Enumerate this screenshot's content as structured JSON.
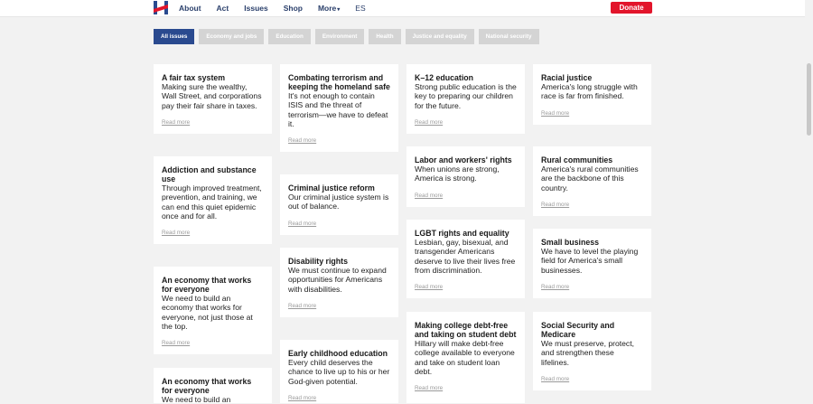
{
  "nav": {
    "items": [
      "About",
      "Act",
      "Issues",
      "Shop",
      "More"
    ],
    "lang": "ES",
    "donate": "Donate"
  },
  "colors": {
    "brand_blue": "#2a4a8f",
    "donate_red": "#e2152b",
    "nav_text": "#2a3f6b"
  },
  "filters": [
    "All issues",
    "Economy and jobs",
    "Education",
    "Environment",
    "Health",
    "Justice and equality",
    "National security"
  ],
  "read_more": "Read more",
  "cards": [
    {
      "title": "A fair tax system",
      "text": "Making sure the wealthy, Wall Street, and corporations pay their fair share in taxes."
    },
    {
      "title": "Addiction and substance use",
      "text": "Through improved treatment, prevention, and training, we can end this quiet epidemic once and for all."
    },
    {
      "title": "An economy that works for everyone",
      "text": "We need to build an economy that works for everyone, not just those at the top."
    },
    {
      "title": "An economy that works for everyone",
      "text": "We need to build an"
    },
    {
      "title": "Combating terrorism and keeping the homeland safe",
      "text": "It's not enough to contain ISIS and the threat of terrorism—we have to defeat it."
    },
    {
      "title": "Criminal justice reform",
      "text": "Our criminal justice system is out of balance."
    },
    {
      "title": "Disability rights",
      "text": "We must continue to expand opportunities for Americans with disabilities."
    },
    {
      "title": "Early childhood education",
      "text": "Every child deserves the chance to live up to his or her God-given potential."
    },
    {
      "title": "K–12 education",
      "text": "Strong public education is the key to preparing our children for the future."
    },
    {
      "title": "Labor and workers' rights",
      "text": "When unions are strong, America is strong."
    },
    {
      "title": "LGBT rights and equality",
      "text": "Lesbian, gay, bisexual, and transgender Americans deserve to live their lives free from discrimination."
    },
    {
      "title": "Making college debt-free and taking on student debt",
      "text": "Hillary will make debt-free college available to everyone and take on student loan debt."
    },
    {
      "title": "Racial justice",
      "text": "America's long struggle with race is far from finished."
    },
    {
      "title": "Rural communities",
      "text": "America's rural communities are the backbone of this country."
    },
    {
      "title": "Small business",
      "text": "We have to level the playing field for America's small businesses."
    },
    {
      "title": "Social Security and Medicare",
      "text": "We must preserve, protect, and strengthen these lifelines."
    }
  ]
}
